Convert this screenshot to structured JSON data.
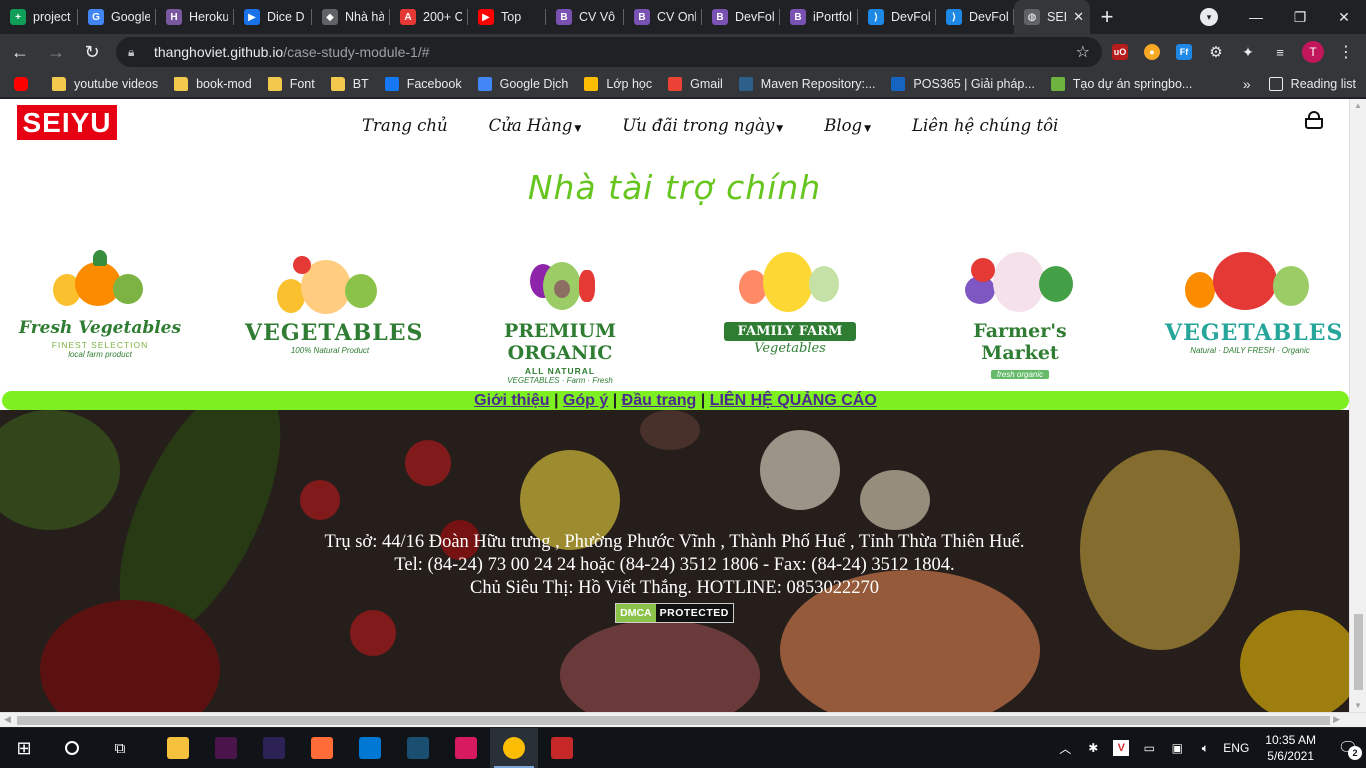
{
  "tabs": [
    {
      "title": "project",
      "color": "#0f9d58",
      "glyph": "+"
    },
    {
      "title": "Google",
      "color": "#4285f4",
      "glyph": "G"
    },
    {
      "title": "Heroku",
      "color": "#79589f",
      "glyph": "H"
    },
    {
      "title": "Dice D",
      "color": "#1a73e8",
      "glyph": "▶"
    },
    {
      "title": "Nhà hà",
      "color": "#5f6368",
      "glyph": "◆"
    },
    {
      "title": "200+ C",
      "color": "#e53935",
      "glyph": "A"
    },
    {
      "title": "Top",
      "color": "#ff0000",
      "glyph": "▶"
    },
    {
      "title": "CV Vô",
      "color": "#7952b3",
      "glyph": "B"
    },
    {
      "title": "CV Onl",
      "color": "#7952b3",
      "glyph": "B"
    },
    {
      "title": "DevFol",
      "color": "#7952b3",
      "glyph": "B"
    },
    {
      "title": "iPortfol",
      "color": "#7952b3",
      "glyph": "B"
    },
    {
      "title": "DevFol",
      "color": "#1e88e5",
      "glyph": "⟩"
    },
    {
      "title": "DevFol",
      "color": "#1e88e5",
      "glyph": "⟩"
    },
    {
      "title": "SEI",
      "color": "#5f6368",
      "glyph": "◍",
      "active": true
    }
  ],
  "toolbar": {
    "url_host": "thanghoviet.github.io",
    "url_path": "/case-study-module-1/#",
    "profile_initial": "T"
  },
  "bookmarks": [
    {
      "label": "youtube videos",
      "type": "folder"
    },
    {
      "label": "book-mod",
      "type": "folder"
    },
    {
      "label": "Font",
      "type": "folder"
    },
    {
      "label": "BT",
      "type": "folder"
    },
    {
      "label": "Facebook",
      "type": "site",
      "color": "#1877f2"
    },
    {
      "label": "Google Dịch",
      "type": "site",
      "color": "#4285f4"
    },
    {
      "label": "Lớp học",
      "type": "site",
      "color": "#fbbc04"
    },
    {
      "label": "Gmail",
      "type": "site",
      "color": "#ea4335"
    },
    {
      "label": "Maven Repository:...",
      "type": "site",
      "color": "#2c5f8a"
    },
    {
      "label": "POS365 | Giải pháp...",
      "type": "site",
      "color": "#1565c0"
    },
    {
      "label": "Tạo dự án springbo...",
      "type": "site",
      "color": "#6db33f"
    }
  ],
  "reading_list": "Reading list",
  "site": {
    "logo": "SEIYU",
    "nav": [
      {
        "label": "Trang chủ",
        "dropdown": false
      },
      {
        "label": "Cửa Hàng",
        "dropdown": true
      },
      {
        "label": "Ưu đãi trong ngày",
        "dropdown": true
      },
      {
        "label": "Blog",
        "dropdown": true
      },
      {
        "label": "Liên hệ chúng tôi",
        "dropdown": false
      }
    ],
    "sponsor_heading": "Nhà tài trợ chính",
    "sponsors": [
      {
        "name": "Fresh Vegetables",
        "sub": "FINEST SELECTION",
        "tag": "local farm product"
      },
      {
        "name": "VEGETABLES",
        "sub": "",
        "tag": "100% Natural Product"
      },
      {
        "name": "PREMIUM ORGANIC",
        "sub": "ALL NATURAL",
        "tag": "VEGETABLES · Farm · Fresh"
      },
      {
        "name": "FAMILY FARM",
        "sub": "",
        "tag": "Vegetables"
      },
      {
        "name": "Farmer's Market",
        "sub": "",
        "tag": "fresh organic"
      },
      {
        "name": "VEGETABLES",
        "sub": "",
        "tag": "Natural · DAILY FRESH · Organic"
      }
    ],
    "footer_links": [
      "Giới thiệu",
      "Góp ý",
      "Đầu trang",
      "LIÊN HỆ QUẢNG CÁO"
    ],
    "footer_address": "Trụ sở: 44/16 Đoàn Hữu trưng , Phường Phước Vĩnh , Thành Phố Huế , Tỉnh Thừa Thiên Huế.",
    "footer_tel": "Tel: (84-24) 73 00 24 24 hoặc (84-24) 3512 1806 - Fax: (84-24) 3512 1804.",
    "footer_owner": "Chủ Siêu Thị: Hồ Viết Thắng. HOTLINE: 0853022270",
    "dmca_left": "DMCA",
    "dmca_right": "PROTECTED"
  },
  "taskbar": {
    "apps": [
      {
        "name": "file-explorer",
        "color": "#f6c23e"
      },
      {
        "name": "slack",
        "color": "#4a154b"
      },
      {
        "name": "eclipse",
        "color": "#2c2255"
      },
      {
        "name": "postman",
        "color": "#ff6c37"
      },
      {
        "name": "vscode",
        "color": "#0078d4"
      },
      {
        "name": "mysql-workbench",
        "color": "#1b4f72"
      },
      {
        "name": "intellij",
        "color": "#d81b60"
      },
      {
        "name": "chrome",
        "color": "#fbbc04",
        "active": true
      },
      {
        "name": "garena",
        "color": "#c62828"
      }
    ],
    "lang": "ENG",
    "time": "10:35 AM",
    "date": "5/6/2021",
    "notifications": "2"
  }
}
